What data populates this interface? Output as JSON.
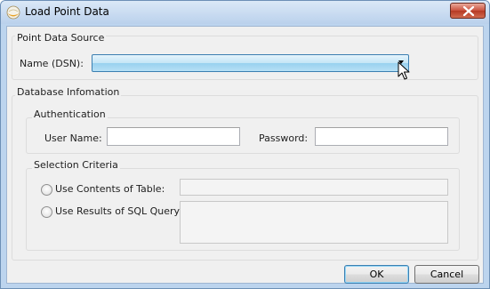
{
  "window": {
    "title": "Load Point Data",
    "close_icon": "close-icon",
    "app_icon": "app-icon"
  },
  "point_data_source": {
    "group_label": "Point Data Source",
    "dsn_label": "Name (DSN):",
    "dsn_value": ""
  },
  "database_information": {
    "group_label": "Database Infomation",
    "authentication": {
      "group_label": "Authentication",
      "user_name_label": "User Name:",
      "user_name_value": "",
      "password_label": "Password:",
      "password_value": ""
    },
    "selection_criteria": {
      "group_label": "Selection Criteria",
      "use_table_label": "Use Contents of Table:",
      "use_table_value": "",
      "use_sql_label": "Use Results of SQL Query:",
      "use_sql_value": ""
    }
  },
  "buttons": {
    "ok_label": "OK",
    "cancel_label": "Cancel"
  },
  "colors": {
    "title_bar": "#bad1ec",
    "combo_highlight": "#98d1ef",
    "close_button": "#c9503c",
    "dialog_background": "#f0f0f0"
  }
}
